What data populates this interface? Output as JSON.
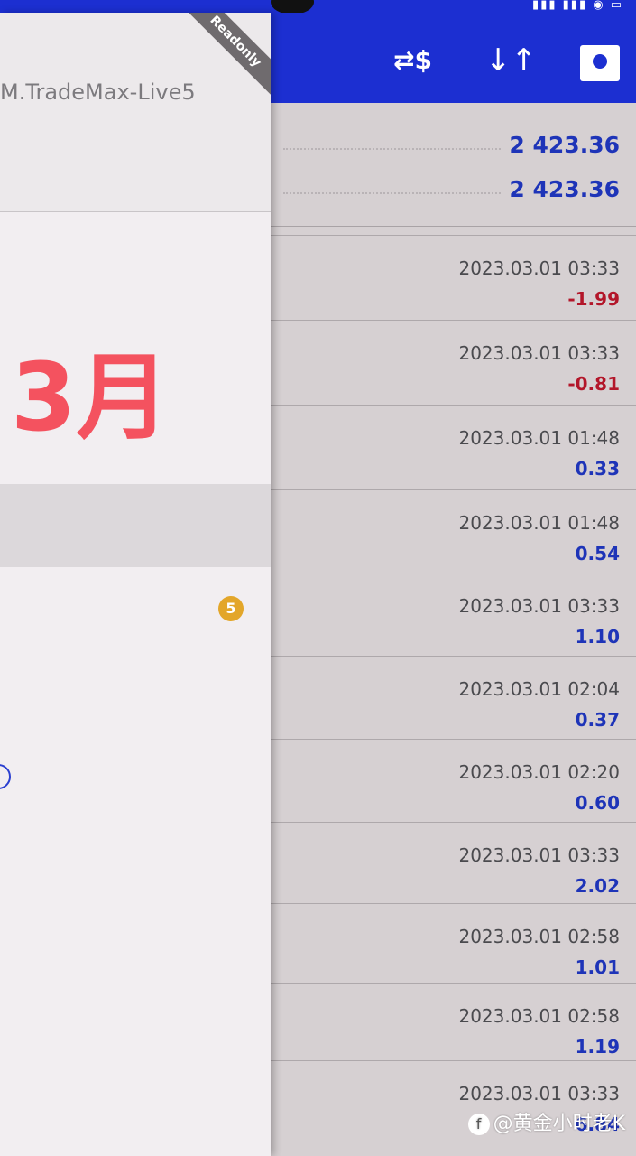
{
  "account": {
    "name": "M.TradeMax-Live5",
    "badge": "Readonly"
  },
  "overlay_month": "3月",
  "notification_count": "5",
  "toolbar": {
    "exchange_icon": "currency-exchange-icon",
    "sort_icon": "sort-arrows-icon",
    "calendar_icon": "calendar-icon"
  },
  "summary": [
    "2 423.36",
    "2 423.36"
  ],
  "deals": [
    {
      "time": "2023.03.01 03:33",
      "profit": "-1.99",
      "negative": true
    },
    {
      "time": "2023.03.01 03:33",
      "profit": "-0.81",
      "negative": true
    },
    {
      "time": "2023.03.01 01:48",
      "profit": "0.33",
      "negative": false
    },
    {
      "time": "2023.03.01 01:48",
      "profit": "0.54",
      "negative": false
    },
    {
      "time": "2023.03.01 03:33",
      "profit": "1.10",
      "negative": false
    },
    {
      "time": "2023.03.01 02:04",
      "profit": "0.37",
      "negative": false
    },
    {
      "time": "2023.03.01 02:20",
      "profit": "0.60",
      "negative": false
    },
    {
      "time": "2023.03.01 03:33",
      "profit": "2.02",
      "negative": false
    },
    {
      "time": "2023.03.01 02:58",
      "profit": "1.01",
      "negative": false
    },
    {
      "time": "2023.03.01 02:58",
      "profit": "1.19",
      "negative": false
    },
    {
      "time": "2023.03.01 03:33",
      "profit": "6.84",
      "negative": false
    }
  ],
  "watermark": "@黄金小时老K",
  "colors": {
    "header": "#1c2fd1",
    "negative": "#b3162a",
    "positive": "#1e34b8",
    "month": "#f4525f"
  }
}
